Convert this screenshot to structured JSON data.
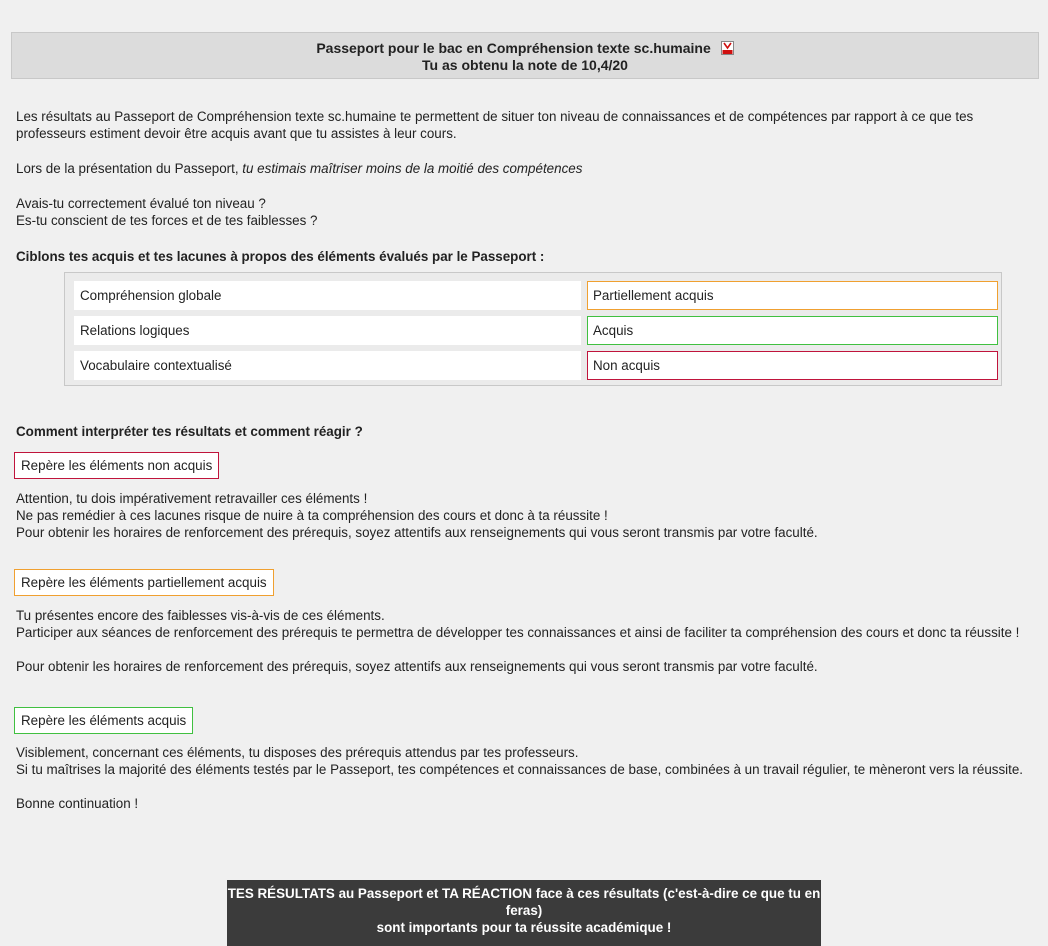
{
  "header": {
    "title": "Passeport pour le bac en Compréhension texte sc.humaine",
    "subtitle": "Tu as obtenu la note de 10,4/20",
    "pdf_icon": "pdf-icon"
  },
  "intro": {
    "paragraph1": "Les résultats au Passeport de Compréhension texte sc.humaine te permettent de situer ton niveau de connaissances et de compétences par rapport à ce que tes professeurs estiment devoir être acquis avant que tu assistes à leur cours.",
    "presentation_prefix": "Lors de la présentation du Passeport, ",
    "presentation_em": "tu estimais maîtriser moins de la moitié des compétences",
    "question1": "Avais-tu correctement évalué ton niveau ?",
    "question2": "Es-tu conscient de tes forces et de tes faiblesses ?",
    "section_heading": "Ciblons tes acquis et tes lacunes à propos des éléments évalués par le Passeport :"
  },
  "results": [
    {
      "label": "Compréhension globale",
      "status": "Partiellement acquis",
      "color": "#f0a030"
    },
    {
      "label": "Relations logiques",
      "status": "Acquis",
      "color": "#40c040"
    },
    {
      "label": "Vocabulaire contextualisé",
      "status": "Non acquis",
      "color": "#c0143c"
    }
  ],
  "interpret": {
    "heading": "Comment interpréter tes résultats et comment réagir ?",
    "non_acquis": {
      "box": "Repère les éléments non acquis",
      "color": "#c0143c",
      "line1": "Attention, tu dois impérativement retravailler ces éléments !",
      "line2": "Ne pas remédier à ces lacunes risque de nuire à ta compréhension des cours et donc à ta réussite !",
      "line3": "Pour obtenir les horaires de renforcement des prérequis, soyez attentifs aux renseignements qui vous seront transmis par votre faculté."
    },
    "partiel": {
      "box": "Repère les éléments partiellement acquis",
      "color": "#f0a030",
      "line1": "Tu présentes encore des faiblesses vis-à-vis de ces éléments.",
      "line2": "Participer aux séances de renforcement des prérequis te permettra de développer tes connaissances et ainsi de faciliter ta compréhension des cours et donc ta réussite !",
      "line3": "Pour obtenir les horaires de renforcement des prérequis, soyez attentifs aux renseignements qui vous seront transmis par votre faculté."
    },
    "acquis": {
      "box": "Repère les éléments acquis",
      "color": "#40c040",
      "line1": "Visiblement, concernant ces éléments, tu disposes des prérequis attendus par tes professeurs.",
      "line2": "Si tu maîtrises la majorité des éléments testés par le Passeport, tes compétences et connaissances de base, combinées à un travail régulier, te mèneront vers la réussite.",
      "line3": "Bonne continuation !"
    }
  },
  "footer": {
    "line1": "TES RÉSULTATS au Passeport et TA RÉACTION face à ces résultats (c'est-à-dire ce que tu en feras)",
    "line2": "sont importants pour ta réussite académique !"
  }
}
